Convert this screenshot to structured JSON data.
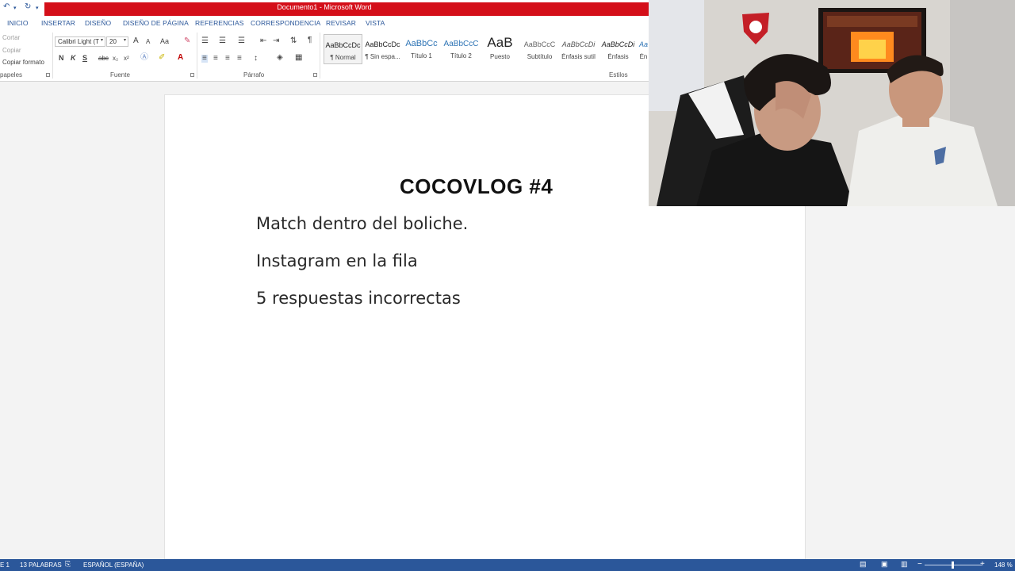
{
  "window": {
    "title": "Documento1 -  Microsoft Word"
  },
  "tabs": [
    "INICIO",
    "INSERTAR",
    "DISEÑO",
    "DISEÑO DE PÁGINA",
    "REFERENCIAS",
    "CORRESPONDENCIA",
    "REVISAR",
    "VISTA"
  ],
  "clipboard": {
    "cut": "Cortar",
    "copy": "Copiar",
    "format_painter": "Copiar formato",
    "label": "papeles"
  },
  "font": {
    "name": "Calibri Light (T",
    "size": "20",
    "label": "Fuente",
    "bold": "N",
    "italic": "K",
    "underline": "S",
    "strike": "abc",
    "sub": "x₂",
    "sup": "x²",
    "grow": "A",
    "shrink": "A",
    "case": "Aa",
    "color": "A"
  },
  "paragraph": {
    "label": "Párrafo",
    "pilcrow": "¶"
  },
  "styles": {
    "label": "Estilos",
    "items": [
      {
        "preview": "AaBbCcDc",
        "name": "¶ Normal"
      },
      {
        "preview": "AaBbCcDc",
        "name": "¶ Sin espa..."
      },
      {
        "preview": "AaBbCc",
        "name": "Título 1"
      },
      {
        "preview": "AaBbCcC",
        "name": "Título 2"
      },
      {
        "preview": "AaB",
        "name": "Puesto"
      },
      {
        "preview": "AaBbCcC",
        "name": "Subtítulo"
      },
      {
        "preview": "AaBbCcDi",
        "name": "Énfasis sutil"
      },
      {
        "preview": "AaBbCcDi",
        "name": "Énfasis"
      },
      {
        "preview": "Aa",
        "name": "Én"
      }
    ]
  },
  "document": {
    "title": "COCOVLOG #4",
    "lines": [
      "Match dentro del boliche.",
      "Instagram en la fila",
      "5 respuestas incorrectas"
    ]
  },
  "status": {
    "page": "E 1",
    "words": "13 PALABRAS",
    "language": "ESPAÑOL (ESPAÑA)",
    "zoom": "148 %",
    "zoom_fraction": 0.49
  },
  "colors": {
    "word_red": "#d40f19",
    "word_blue": "#2b579a"
  }
}
